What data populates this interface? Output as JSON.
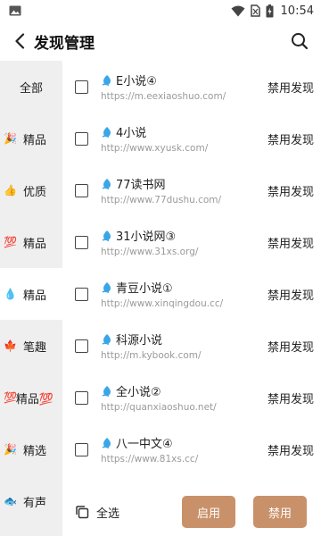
{
  "status_bar": {
    "time": "10:54"
  },
  "header": {
    "title": "发现管理"
  },
  "sidebar": {
    "items": [
      {
        "label": "全部",
        "emoji": ""
      },
      {
        "label": "精品",
        "emoji": "🎉"
      },
      {
        "label": "优质",
        "emoji": "👍"
      },
      {
        "label": "精品",
        "emoji": "💯"
      },
      {
        "label": "精品",
        "emoji": "💧"
      },
      {
        "label": "笔趣",
        "emoji": "🍁"
      },
      {
        "label": "精品💯",
        "emoji": "💯"
      },
      {
        "label": "精选",
        "emoji": "🎉"
      },
      {
        "label": "有声",
        "emoji": "🐟"
      }
    ]
  },
  "sources": [
    {
      "name": "E小说④",
      "url": "https://m.eexiaoshuo.com/",
      "action": "禁用发现"
    },
    {
      "name": "4小说",
      "url": "http://www.xyusk.com/",
      "action": "禁用发现"
    },
    {
      "name": "77读书网",
      "url": "http://www.77dushu.com/",
      "action": "禁用发现"
    },
    {
      "name": "31小说网③",
      "url": "http://www.31xs.org/",
      "action": "禁用发现"
    },
    {
      "name": "青豆小说①",
      "url": "http://www.xinqingdou.cc/",
      "action": "禁用发现"
    },
    {
      "name": "科源小说",
      "url": "http://m.kybook.com/",
      "action": "禁用发现"
    },
    {
      "name": "全小说②",
      "url": "http://quanxiaoshuo.net/",
      "action": "禁用发现"
    },
    {
      "name": "八一中文④",
      "url": "https://www.81xs.cc/",
      "action": "禁用发现"
    }
  ],
  "bottom_bar": {
    "select_all": "全选",
    "enable": "启用",
    "disable": "禁用"
  },
  "colors": {
    "accent": "#c9916a",
    "drop_icon": "#3aa6e8"
  }
}
